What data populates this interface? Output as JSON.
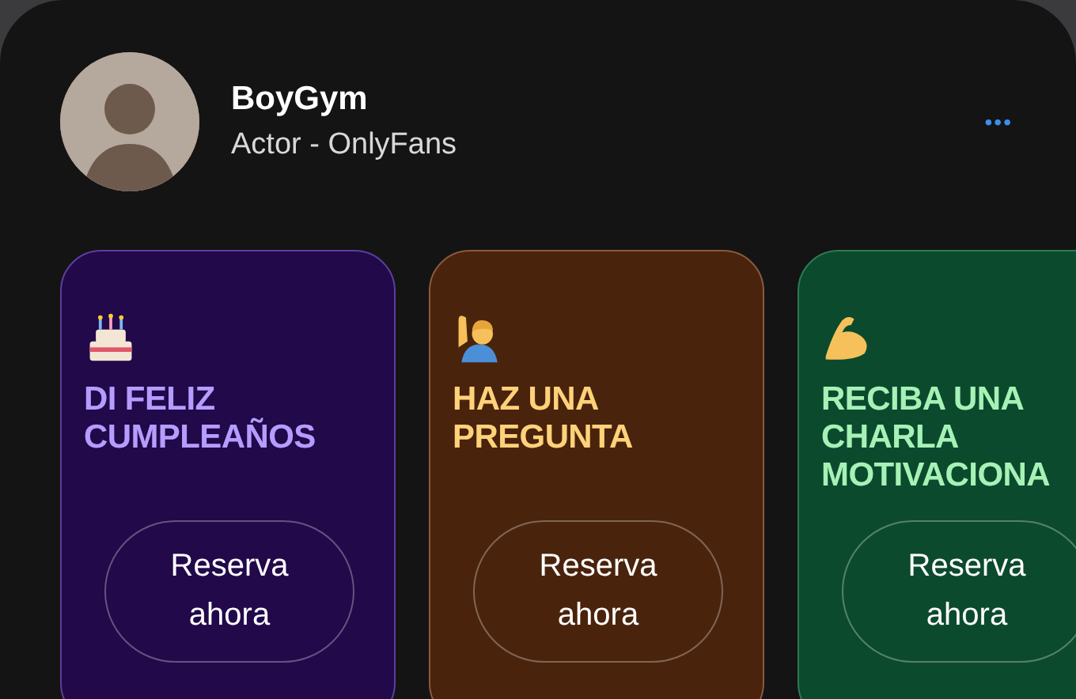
{
  "profile": {
    "name": "BoyGym",
    "subtitle": "Actor - OnlyFans",
    "menu": "•••"
  },
  "cards": [
    {
      "kind": "cake",
      "title": "DI FELIZ CUMPLEAÑOS",
      "button": "Reserva ahora",
      "color": "#21094a"
    },
    {
      "kind": "hand",
      "title": "HAZ UNA PREGUNTA",
      "button": "Reserva ahora",
      "color": "#4a230c"
    },
    {
      "kind": "arm",
      "title": "RECIBA UNA CHARLA MOTIVACIONA",
      "button": "Reserva ahora",
      "color": "#0c4a2e"
    }
  ]
}
